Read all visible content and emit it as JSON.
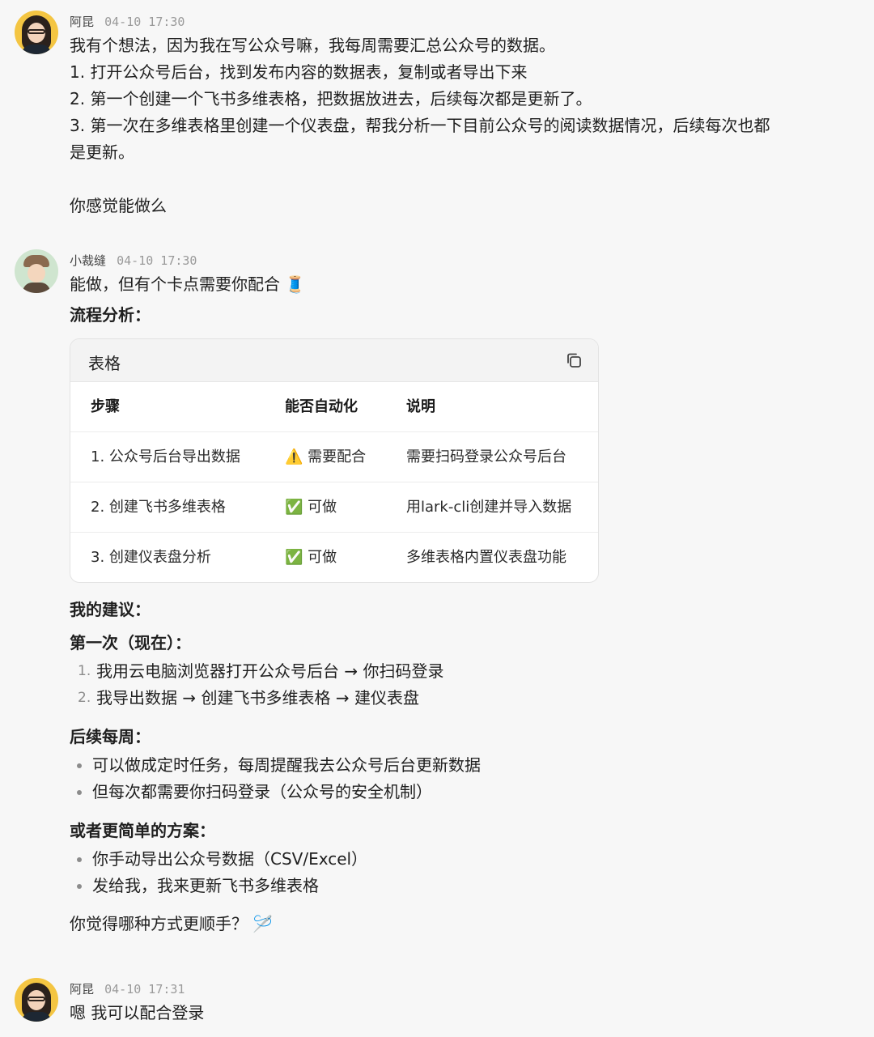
{
  "messages": [
    {
      "sender": "阿昆",
      "time": "04-10 17:30",
      "lines": [
        "我有个想法，因为我在写公众号嘛，我每周需要汇总公众号的数据。",
        "1. 打开公众号后台，找到发布内容的数据表，复制或者导出下来",
        "2. 第一个创建一个飞书多维表格，把数据放进去，后续每次都是更新了。",
        "3. 第一次在多维表格里创建一个仪表盘，帮我分析一下目前公众号的阅读数据情况，后续每次也都",
        "是更新。",
        "",
        "你感觉能做么"
      ]
    },
    {
      "sender": "小裁缝",
      "time": "04-10 17:30",
      "intro": "能做，但有个卡点需要你配合 🧵",
      "flow_heading": "流程分析：",
      "table": {
        "title": "表格",
        "copy_icon": "copy-icon",
        "headers": [
          "步骤",
          "能否自动化",
          "说明"
        ],
        "rows": [
          [
            "1. 公众号后台导出数据",
            "⚠️ 需要配合",
            "需要扫码登录公众号后台"
          ],
          [
            "2. 创建飞书多维表格",
            "✅ 可做",
            "用lark-cli创建并导入数据"
          ],
          [
            "3. 创建仪表盘分析",
            "✅ 可做",
            "多维表格内置仪表盘功能"
          ]
        ]
      },
      "suggest_heading": "我的建议：",
      "first_heading": "第一次（现在）：",
      "first_steps": [
        {
          "num": "1.",
          "text": "我用云电脑浏览器打开公众号后台 → 你扫码登录"
        },
        {
          "num": "2.",
          "text": "我导出数据 → 创建飞书多维表格 → 建仪表盘"
        }
      ],
      "weekly_heading": "后续每周：",
      "weekly_items": [
        "可以做成定时任务，每周提醒我去公众号后台更新数据",
        "但每次都需要你扫码登录（公众号的安全机制）"
      ],
      "simple_heading": "或者更简单的方案：",
      "simple_items": [
        "你手动导出公众号数据（CSV/Excel）",
        "发给我，我来更新飞书多维表格"
      ],
      "closing": "你觉得哪种方式更顺手？ 🪡"
    },
    {
      "sender": "阿昆",
      "time": "04-10 17:31",
      "text": "嗯 我可以配合登录"
    }
  ]
}
